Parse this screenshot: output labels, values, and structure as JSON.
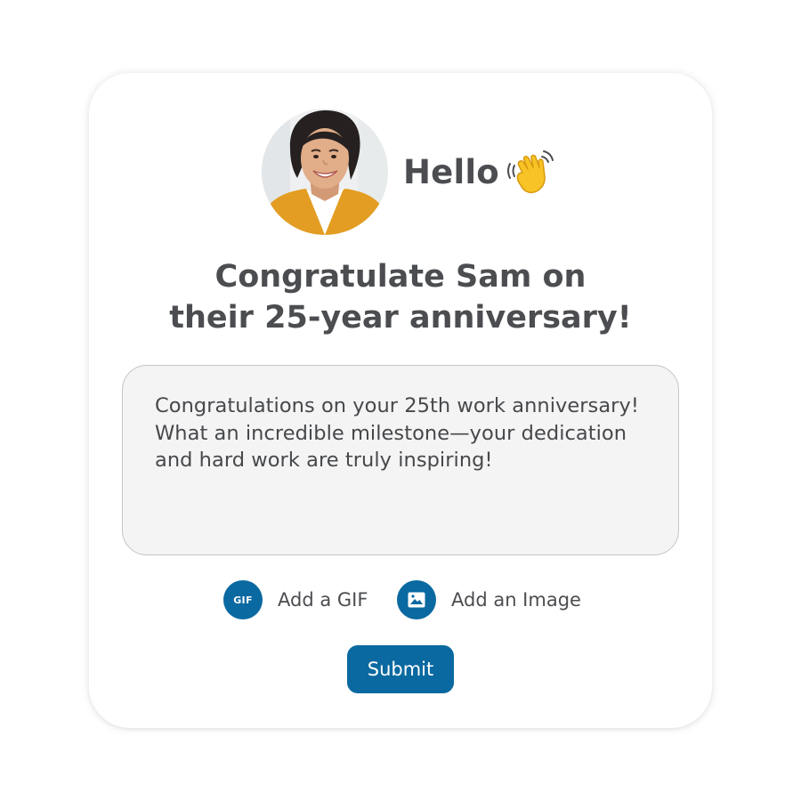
{
  "greeting": {
    "text": "Hello",
    "emoji": "waving-hand"
  },
  "headline": {
    "line1": "Congratulate Sam on",
    "line2": "their 25-year anniversary!"
  },
  "message": {
    "value": "Congratulations on your 25th work anniversary!\nWhat an incredible milestone—your dedication\nand hard work are truly inspiring!"
  },
  "actions": {
    "gif_icon_text": "GIF",
    "gif_label": "Add a GIF",
    "image_label": "Add an Image",
    "gif_icon": "gif-icon",
    "image_icon": "image-icon"
  },
  "submit": {
    "label": "Submit"
  },
  "colors": {
    "accent": "#0a69a0",
    "text": "#4b4d50",
    "input_bg": "#f4f4f4",
    "input_border": "#c5c5c5"
  }
}
